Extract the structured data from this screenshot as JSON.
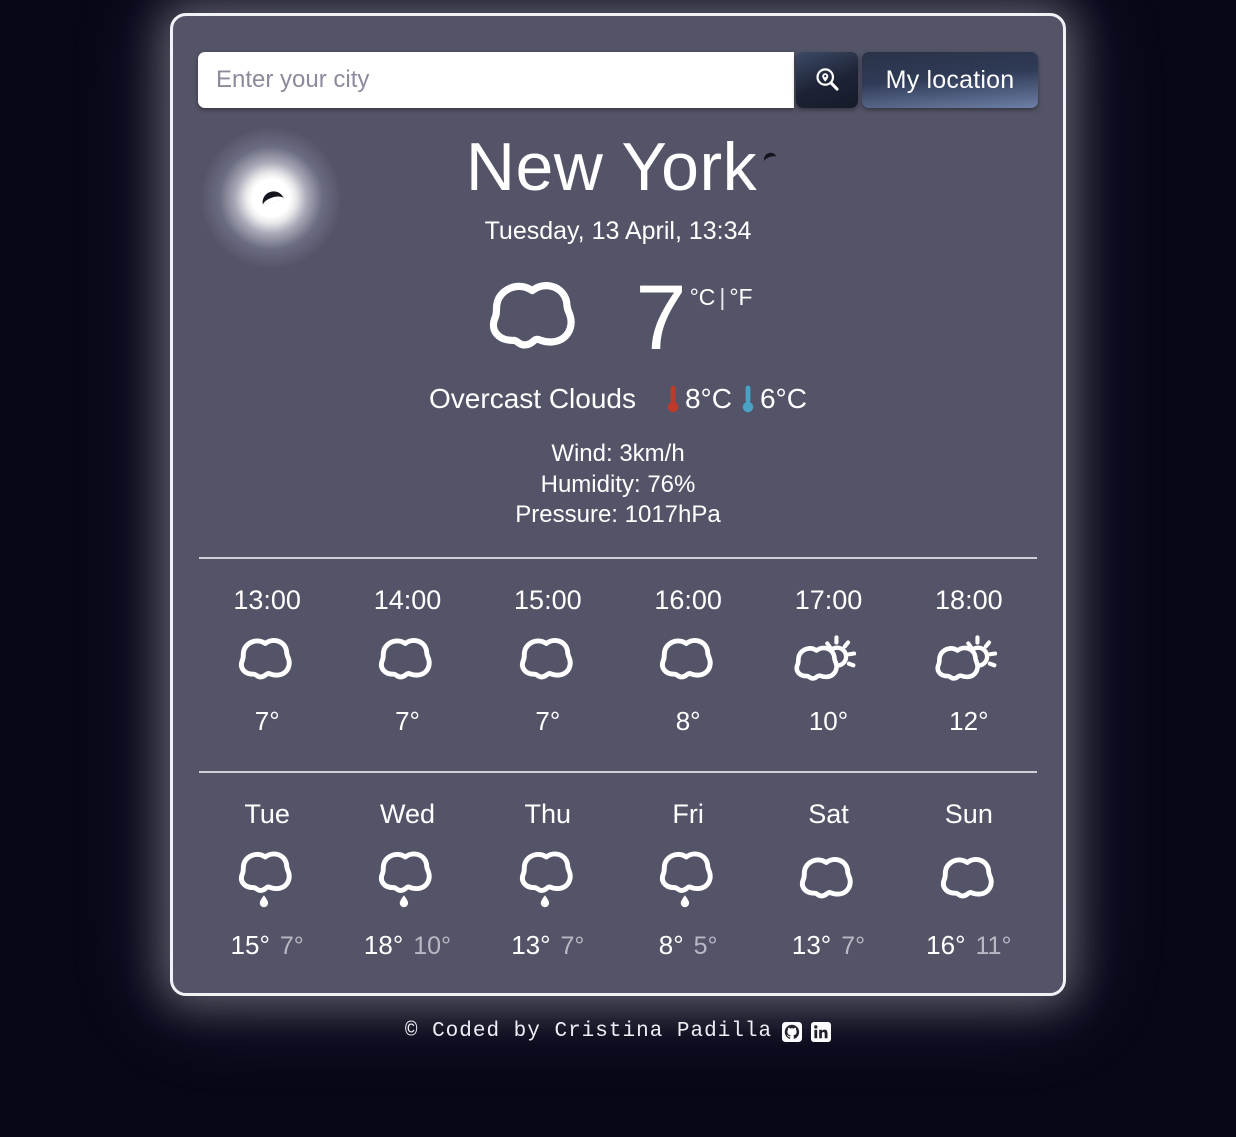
{
  "search": {
    "placeholder": "Enter your city",
    "value": "",
    "search_button_icon": "search-location-icon",
    "location_button_label": "My location"
  },
  "current": {
    "city": "New York",
    "date": "Tuesday, 13 April, 13:34",
    "icon": "cloud-icon",
    "temperature": "7",
    "unit_celsius": "°C",
    "unit_separator": "|",
    "unit_fahrenheit": "°F",
    "description": "Overcast Clouds",
    "temp_max": "8°C",
    "temp_min": "6°C",
    "temp_max_icon": "thermometer-hot-icon",
    "temp_min_icon": "thermometer-cold-icon",
    "temp_max_color": "#c0392b",
    "temp_min_color": "#4aa3c7",
    "wind": "Wind: 3km/h",
    "humidity": "Humidity: 76%",
    "pressure": "Pressure: 1017hPa"
  },
  "hourly": [
    {
      "time": "13:00",
      "icon": "cloud-icon",
      "temp": "7°"
    },
    {
      "time": "14:00",
      "icon": "cloud-icon",
      "temp": "7°"
    },
    {
      "time": "15:00",
      "icon": "cloud-icon",
      "temp": "7°"
    },
    {
      "time": "16:00",
      "icon": "cloud-icon",
      "temp": "8°"
    },
    {
      "time": "17:00",
      "icon": "sun-behind-cloud-icon",
      "temp": "10°"
    },
    {
      "time": "18:00",
      "icon": "sun-behind-cloud-icon",
      "temp": "12°"
    }
  ],
  "daily": [
    {
      "day": "Tue",
      "icon": "rain-cloud-icon",
      "max": "15°",
      "min": "7°"
    },
    {
      "day": "Wed",
      "icon": "rain-cloud-icon",
      "max": "18°",
      "min": "10°"
    },
    {
      "day": "Thu",
      "icon": "rain-cloud-icon",
      "max": "13°",
      "min": "7°"
    },
    {
      "day": "Fri",
      "icon": "rain-cloud-icon",
      "max": "8°",
      "min": "5°"
    },
    {
      "day": "Sat",
      "icon": "cloud-icon",
      "max": "13°",
      "min": "7°"
    },
    {
      "day": "Sun",
      "icon": "cloud-icon",
      "max": "16°",
      "min": "11°"
    }
  ],
  "footer": {
    "credit": "© Coded by Cristina Padilla",
    "github_icon": "github-icon",
    "linkedin_icon": "linkedin-icon"
  },
  "theme": {
    "page_background": "#070718",
    "card_background": "#545468",
    "card_border": "#f2f2f6",
    "text_primary": "#ffffff",
    "text_muted": "#b9b9c6"
  }
}
